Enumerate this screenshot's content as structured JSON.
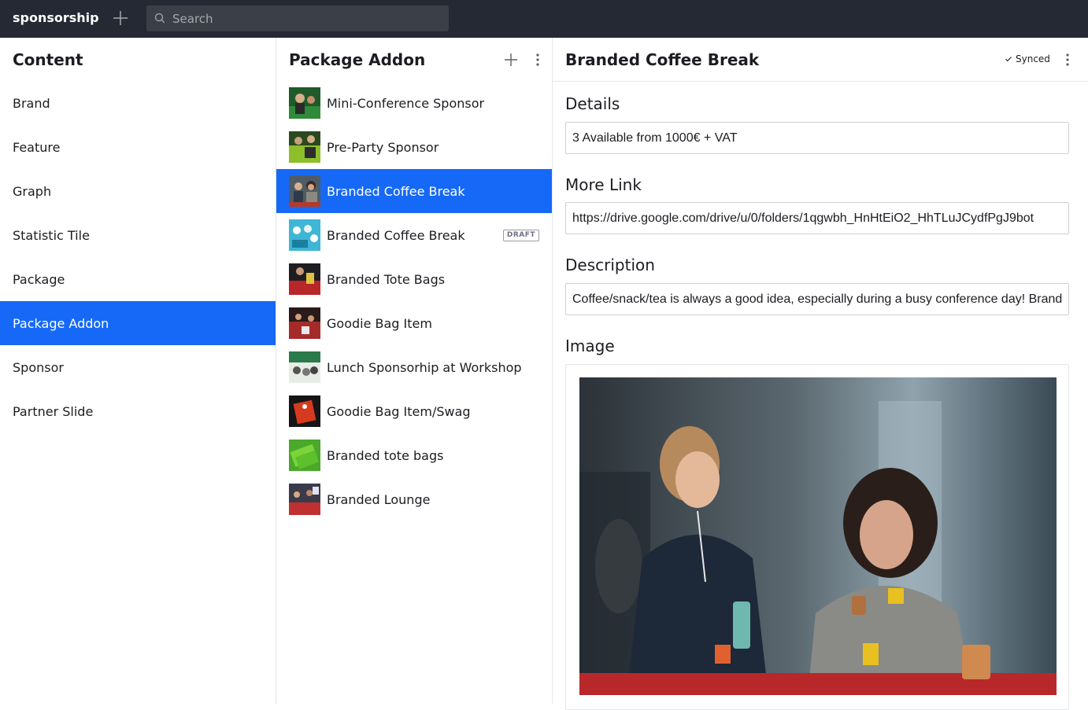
{
  "app": {
    "name": "sponsorship",
    "search_placeholder": "Search"
  },
  "content_pane": {
    "title": "Content",
    "items": [
      {
        "label": "Brand"
      },
      {
        "label": "Feature"
      },
      {
        "label": "Graph"
      },
      {
        "label": "Statistic Tile"
      },
      {
        "label": "Package"
      },
      {
        "label": "Package Addon",
        "selected": true
      },
      {
        "label": "Sponsor"
      },
      {
        "label": "Partner Slide"
      }
    ]
  },
  "list_pane": {
    "title": "Package Addon",
    "items": [
      {
        "label": "Mini-Conference Sponsor"
      },
      {
        "label": "Pre-Party Sponsor"
      },
      {
        "label": "Branded Coffee Break",
        "selected": true
      },
      {
        "label": "Branded Coffee Break",
        "badge": "DRAFT"
      },
      {
        "label": "Branded Tote Bags"
      },
      {
        "label": "Goodie Bag Item"
      },
      {
        "label": "Lunch Sponsorhip at Workshop"
      },
      {
        "label": "Goodie Bag Item/Swag"
      },
      {
        "label": "Branded tote bags"
      },
      {
        "label": "Branded Lounge"
      }
    ]
  },
  "document": {
    "title": "Branded Coffee Break",
    "status": "Synced",
    "fields": {
      "details_label": "Details",
      "details_value": "3 Available from 1000€ + VAT",
      "more_link_label": "More Link",
      "more_link_value": "https://drive.google.com/drive/u/0/folders/1qgwbh_HnHtEiO2_HhTLuJCydfPgJ9bot",
      "description_label": "Description",
      "description_value": "Coffee/snack/tea is always a good idea, especially during a busy conference day! Brand",
      "image_label": "Image"
    }
  },
  "colors": {
    "topbar": "#252933",
    "accent": "#1669f6"
  }
}
